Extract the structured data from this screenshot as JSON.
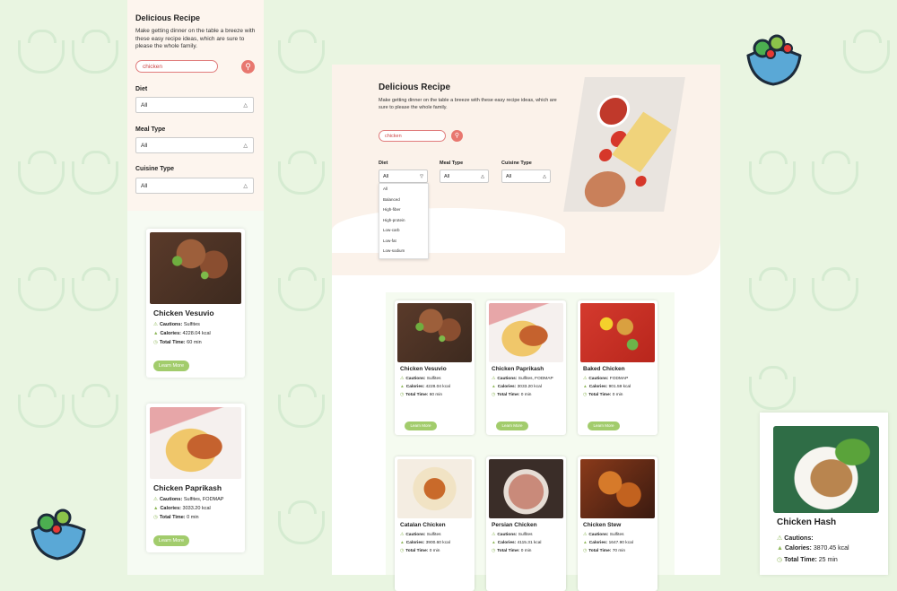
{
  "app": {
    "title": "Delicious Recipe",
    "description": "Make getting dinner on the table a breeze with these easy recipe ideas, which are sure to please the whole family."
  },
  "search": {
    "value": "chicken"
  },
  "filters": {
    "diet": {
      "label": "Diet",
      "value": "All"
    },
    "meal_type": {
      "label": "Meal Type",
      "value": "All"
    },
    "cuisine_type": {
      "label": "Cuisine Type",
      "value": "All"
    }
  },
  "diet_options": [
    "All",
    "Balanced",
    "High-fiber",
    "High-protein",
    "Low-carb",
    "Low-fat",
    "Low-sodium"
  ],
  "labels": {
    "cautions": "Cautions:",
    "calories": "Calories:",
    "total_time": "Total Time:",
    "learn_more": "Learn More"
  },
  "recipes": [
    {
      "name": "Chicken Vesuvio",
      "cautions": "Sulfites",
      "calories": "4228.04 kcal",
      "time": "60 min"
    },
    {
      "name": "Chicken Paprikash",
      "cautions": "Sulfites, FODMAP",
      "calories": "3033.20 kcal",
      "time": "0 min"
    },
    {
      "name": "Baked Chicken",
      "cautions": "FODMAP",
      "calories": "901.59 kcal",
      "time": "0 min"
    },
    {
      "name": "Catalan Chicken",
      "cautions": "Sulfites",
      "calories": "3900.60 kcal",
      "time": "0 min"
    },
    {
      "name": "Persian Chicken",
      "cautions": "Sulfites",
      "calories": "4115.31 kcal",
      "time": "0 min"
    },
    {
      "name": "Chicken Stew",
      "cautions": "Sulfites",
      "calories": "1647.90 kcal",
      "time": "70 min"
    },
    {
      "name": "Chicken Hash",
      "cautions": "",
      "calories": "3870.45 kcal",
      "time": "25 min"
    }
  ],
  "colors": {
    "accent": "#e8776f",
    "button": "#a2cc6c",
    "background": "#e9f5e1"
  }
}
